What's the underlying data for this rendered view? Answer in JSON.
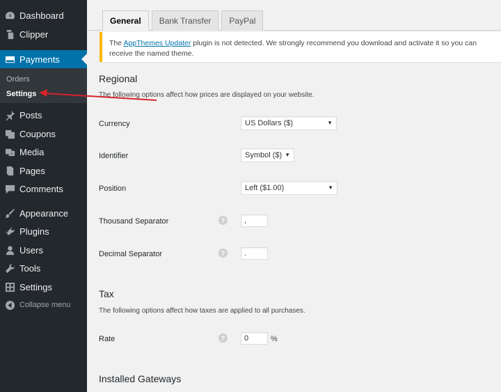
{
  "sidebar": {
    "items": [
      {
        "label": "Dashboard",
        "icon": "dashboard-icon"
      },
      {
        "label": "Clipper",
        "icon": "clipper-icon"
      },
      {
        "label": "Payments",
        "icon": "payments-icon"
      },
      {
        "label": "Posts",
        "icon": "pin-icon"
      },
      {
        "label": "Coupons",
        "icon": "coupons-icon"
      },
      {
        "label": "Media",
        "icon": "media-icon"
      },
      {
        "label": "Pages",
        "icon": "pages-icon"
      },
      {
        "label": "Comments",
        "icon": "comments-icon"
      },
      {
        "label": "Appearance",
        "icon": "brush-icon"
      },
      {
        "label": "Plugins",
        "icon": "plugin-icon"
      },
      {
        "label": "Users",
        "icon": "users-icon"
      },
      {
        "label": "Tools",
        "icon": "wrench-icon"
      },
      {
        "label": "Settings",
        "icon": "settings-icon"
      }
    ],
    "submenu": [
      {
        "label": "Orders"
      },
      {
        "label": "Settings"
      }
    ],
    "collapse_label": "Collapse menu"
  },
  "tabs": [
    "General",
    "Bank Transfer",
    "PayPal"
  ],
  "notice": {
    "prefix": "The ",
    "link": "AppThemes Updater",
    "suffix": " plugin is not detected. We strongly recommend you download and activate it so you can receive the named theme."
  },
  "regional": {
    "title": "Regional",
    "description": "The following options affect how prices are displayed on your website.",
    "currency": {
      "label": "Currency",
      "value": "US Dollars ($)"
    },
    "identifier": {
      "label": "Identifier",
      "value": "Symbol ($)"
    },
    "position": {
      "label": "Position",
      "value": "Left ($1.00)"
    },
    "thousand": {
      "label": "Thousand Separator",
      "value": ","
    },
    "decimal": {
      "label": "Decimal Separator",
      "value": "."
    }
  },
  "tax": {
    "title": "Tax",
    "description": "The following options affect how taxes are applied to all purchases.",
    "rate": {
      "label": "Rate",
      "value": "0",
      "unit": "%"
    }
  },
  "gateways": {
    "title": "Installed Gateways"
  },
  "colors": {
    "sidebar": "#23282d",
    "active": "#0073aa",
    "notice_border": "#ffb900",
    "arrow": "#d6232a"
  }
}
